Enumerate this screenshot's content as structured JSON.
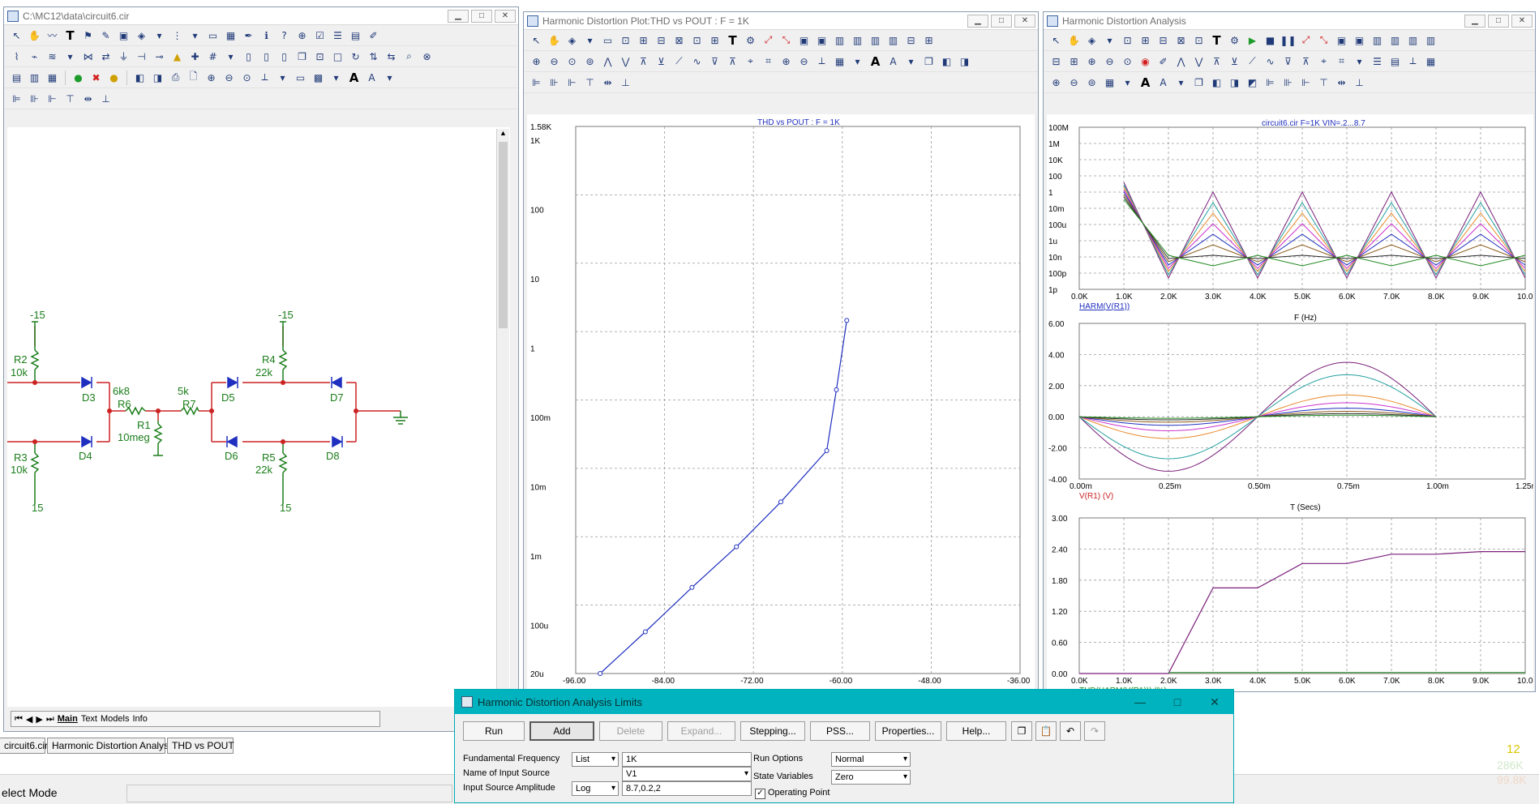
{
  "schematic_window": {
    "title": "C:\\MC12\\data\\circuit6.cir",
    "labels": {
      "m15_left": "-15",
      "r2": "R2",
      "r2v": "10k",
      "r3": "R3",
      "r3v": "10k",
      "p15_left": "15",
      "d3": "D3",
      "d4": "D4",
      "r6v": "6k8",
      "r6": "R6",
      "r7v": "5k",
      "r7": "R7",
      "r1": "R1",
      "r1v": "10meg",
      "d5": "D5",
      "d6": "D6",
      "m15_right": "-15",
      "r4": "R4",
      "r4v": "22k",
      "r5": "R5",
      "r5v": "22k",
      "p15_right": "15",
      "d7": "D7",
      "d8": "D8"
    },
    "page_tabs": [
      "Main",
      "Text",
      "Models",
      "Info"
    ]
  },
  "thd_window": {
    "title": "Harmonic Distortion Plot:THD vs POUT : F = 1K"
  },
  "analysis_window": {
    "title": "Harmonic Distortion Analysis"
  },
  "chart_data": [
    {
      "type": "line",
      "title": "THD vs POUT : F = 1K",
      "xlim": [
        -96,
        -36
      ],
      "x_ticks": [
        "-96.00",
        "-84.00",
        "-72.00",
        "-60.00",
        "-48.00",
        "-36.00"
      ],
      "y_scale": "log",
      "y_ticks": [
        "1.58K",
        "1K",
        "100",
        "10",
        "1",
        "100m",
        "10m",
        "1m",
        "100u",
        "20u"
      ],
      "series": [
        {
          "x": [
            -92.7,
            -86.6,
            -80.3,
            -74.3,
            -68.3,
            -62.1,
            -60.8,
            -59.4
          ],
          "y": [
            2e-05,
            8e-05,
            0.00035,
            0.00135,
            0.006,
            0.033,
            0.25,
            2.5
          ],
          "color": "#1f2fbf"
        }
      ]
    },
    {
      "type": "line",
      "title": "circuit6.cir F=1K VIN=.2...8.7",
      "xlabel": "F (Hz)",
      "ylabel": "HARM(V(R1))",
      "x_ticks": [
        "0.0K",
        "1.0K",
        "2.0K",
        "3.0K",
        "4.0K",
        "5.0K",
        "6.0K",
        "7.0K",
        "8.0K",
        "9.0K",
        "10.0K"
      ],
      "y_scale": "log",
      "y_ticks": [
        "100M",
        "1M",
        "10K",
        "100",
        "1",
        "10m",
        "100u",
        "1u",
        "10n",
        "100p",
        "1p"
      ],
      "xlim": [
        0,
        10000
      ],
      "series_colors": [
        "#7a1f7a",
        "#26a0a0",
        "#e88a2a",
        "#cc33cc",
        "#1f2fbf",
        "#8a5a1a",
        "#2a2a2a",
        "#1f8a1f"
      ]
    },
    {
      "type": "line",
      "xlabel": "T (Secs)",
      "ylabel": "V(R1) (V)",
      "x_ticks": [
        "0.00m",
        "0.25m",
        "0.50m",
        "0.75m",
        "1.00m",
        "1.25m"
      ],
      "y_ticks": [
        "6.00",
        "4.00",
        "2.00",
        "0.00",
        "-2.00",
        "-4.00"
      ],
      "xlim": [
        0,
        0.00125
      ],
      "ylim": [
        -4,
        6
      ],
      "amplitudes": [
        3.5,
        2.7,
        1.4,
        0.9,
        0.55,
        0.35,
        0.2,
        0.1
      ],
      "series_colors": [
        "#7a1f7a",
        "#26a0a0",
        "#e88a2a",
        "#cc33cc",
        "#1f2fbf",
        "#8a5a1a",
        "#2a2a2a",
        "#1f8a1f"
      ]
    },
    {
      "type": "line",
      "xlabel": "F (Hz)",
      "ylabel": "THD(HARM(V(R1))) (%)",
      "x_ticks": [
        "0.0K",
        "1.0K",
        "2.0K",
        "3.0K",
        "4.0K",
        "5.0K",
        "6.0K",
        "7.0K",
        "8.0K",
        "9.0K",
        "10.0K"
      ],
      "y_ticks": [
        "3.00",
        "2.40",
        "1.80",
        "1.20",
        "0.60",
        "0.00"
      ],
      "xlim": [
        0,
        10000
      ],
      "ylim": [
        0,
        3
      ],
      "series": [
        {
          "x": [
            0,
            2000,
            3000,
            4000,
            5000,
            6000,
            7000,
            8000,
            9000,
            10000
          ],
          "y": [
            0,
            0,
            1.65,
            1.65,
            2.12,
            2.12,
            2.3,
            2.3,
            2.35,
            2.35
          ],
          "color": "#7a1f7a"
        }
      ]
    }
  ],
  "bottom_tabs": [
    "circuit6.cir",
    "Harmonic Distortion Analysis",
    "THD vs POUT"
  ],
  "status": {
    "mode": "elect Mode",
    "num1": "12",
    "num2": "286K",
    "num3": "99.8K"
  },
  "dialog": {
    "title": "Harmonic Distortion Analysis Limits",
    "buttons": {
      "run": "Run",
      "add": "Add",
      "delete": "Delete",
      "expand": "Expand...",
      "stepping": "Stepping...",
      "pss": "PSS...",
      "properties": "Properties...",
      "help": "Help..."
    },
    "fields": {
      "fund_freq_label": "Fundamental Frequency",
      "fund_freq_mode": "List",
      "fund_freq_value": "1K",
      "input_source_label": "Name of Input Source",
      "input_source_value": "V1",
      "amplitude_label": "Input Source Amplitude",
      "amplitude_mode": "Log",
      "amplitude_value": "8.7,0.2,2",
      "run_options_label": "Run Options",
      "run_options_value": "Normal",
      "state_vars_label": "State Variables",
      "state_vars_value": "Zero",
      "operating_point_label": "Operating Point"
    }
  }
}
